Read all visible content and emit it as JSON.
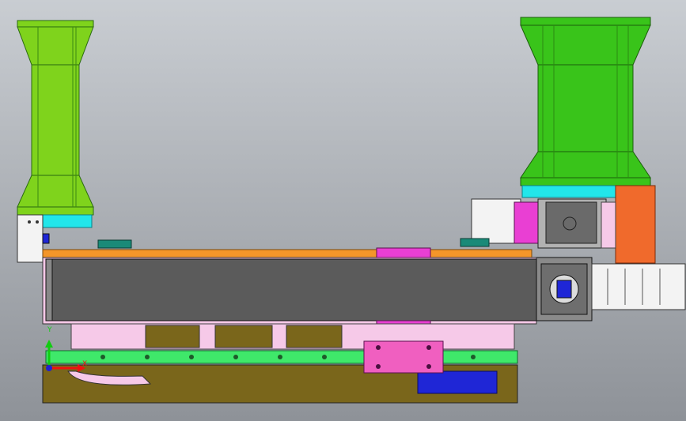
{
  "viewport": {
    "background_top": "#c9cdd2",
    "background_bottom": "#8e9298",
    "view": "front"
  },
  "colors": {
    "motor_green_light": "#7fd31c",
    "motor_green_dark": "#39c41a",
    "cyan_flange": "#22e6ea",
    "orange_strip": "#f4962a",
    "orange_block": "#f06a2c",
    "magenta": "#e93fd3",
    "pink_block": "#f05fc0",
    "light_pink": "#f6c9e8",
    "rail_green": "#3fe86a",
    "gray_cover": "#5b5b5b",
    "olive": "#7a661b",
    "blue_block": "#1f26d6",
    "teal_bracket": "#1a8a78",
    "white_part": "#f3f3f3"
  },
  "components": [
    "left-motor",
    "right-motor",
    "linear-module-cover",
    "guide-rail",
    "slider-block",
    "base-plate",
    "coupling-housing",
    "servo-gearbox"
  ],
  "triad": {
    "x_label": "X",
    "y_label": "Y"
  }
}
